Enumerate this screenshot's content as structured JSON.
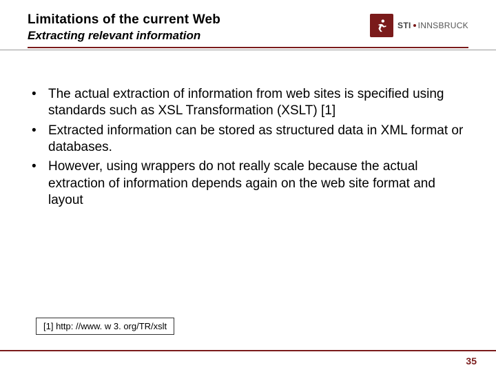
{
  "header": {
    "title": "Limitations of the current Web",
    "subtitle": "Extracting relevant information",
    "logo_text_primary": "STI",
    "logo_text_secondary": "INNSBRUCK"
  },
  "bullets": [
    "The actual extraction of information from web sites is specified using standards such as XSL Transformation (XSLT) [1]",
    "Extracted information can be stored as structured data in XML format or databases.",
    "However, using wrappers do not really scale because the actual extraction of information depends again on the web site format and layout"
  ],
  "footnote": "[1] http: //www. w 3. org/TR/xslt",
  "page_number": "35",
  "colors": {
    "accent": "#7a1a1a"
  }
}
